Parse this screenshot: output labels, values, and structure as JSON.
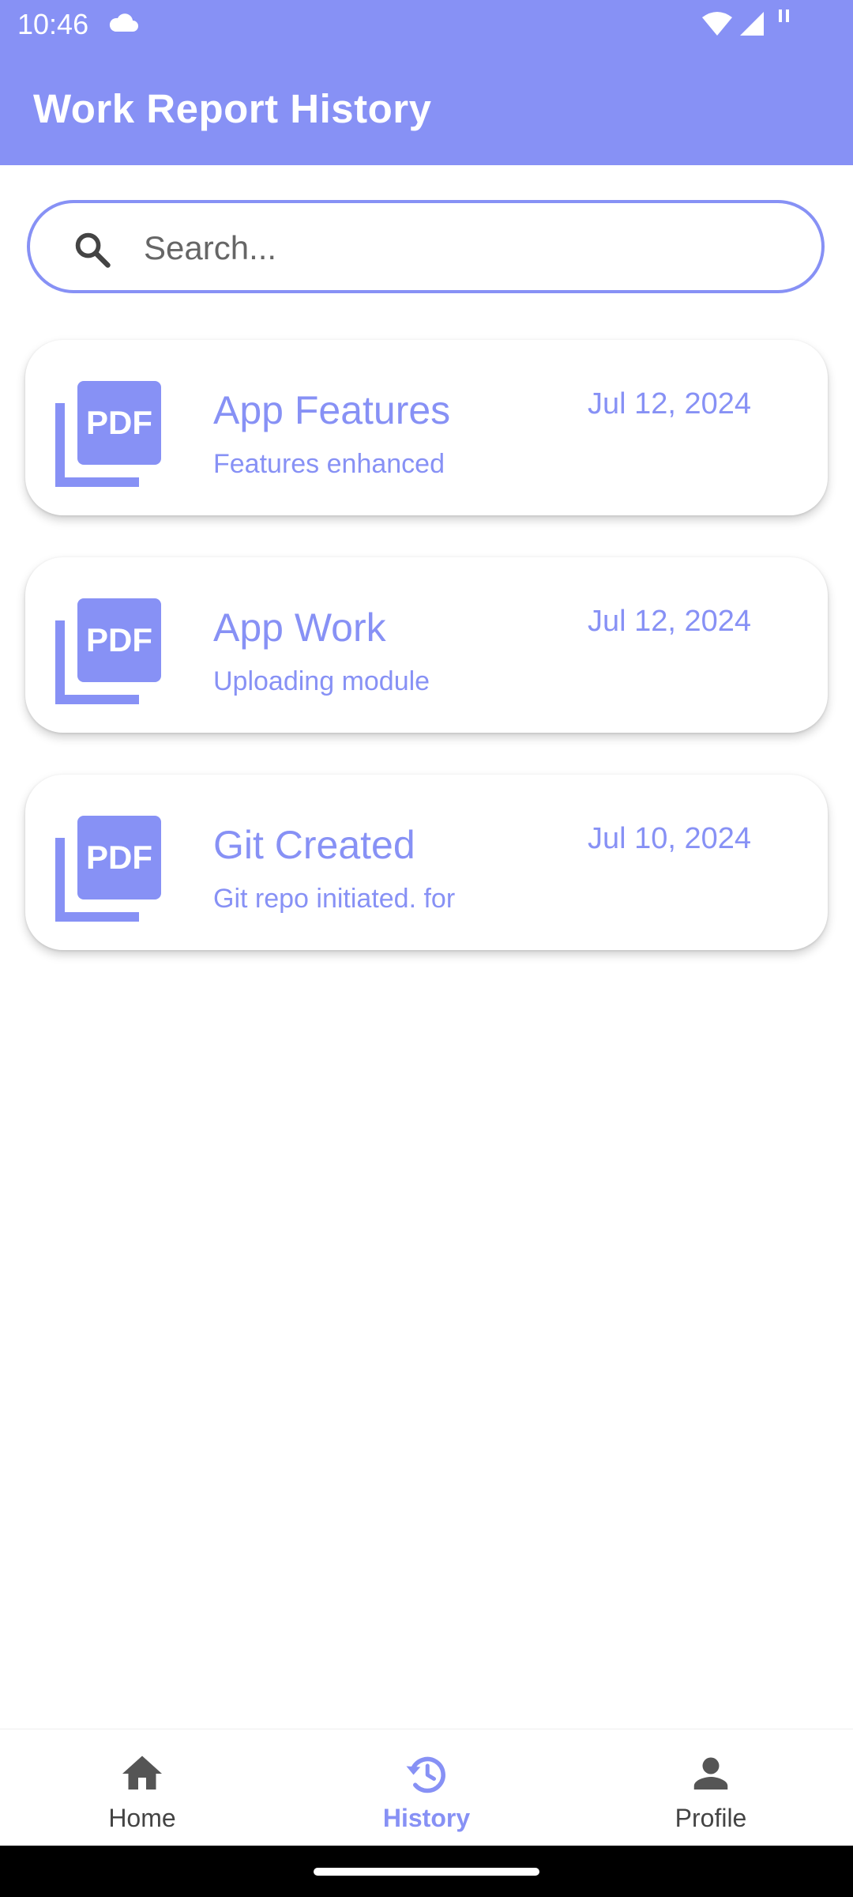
{
  "status_bar": {
    "time": "10:46"
  },
  "app_bar": {
    "title": "Work Report History"
  },
  "search": {
    "placeholder": "Search..."
  },
  "reports": [
    {
      "title": "App Features",
      "subtitle": "Features enhanced",
      "date": "Jul 12, 2024",
      "icon": "pdf-icon"
    },
    {
      "title": "App Work",
      "subtitle": "Uploading module",
      "date": "Jul 12, 2024",
      "icon": "pdf-icon"
    },
    {
      "title": "Git Created",
      "subtitle": "Git repo initiated. for",
      "date": "Jul 10, 2024",
      "icon": "pdf-icon"
    }
  ],
  "bottom_nav": {
    "items": [
      {
        "label": "Home",
        "icon": "home-icon",
        "active": false
      },
      {
        "label": "History",
        "icon": "history-icon",
        "active": true
      },
      {
        "label": "Profile",
        "icon": "profile-icon",
        "active": false
      }
    ]
  },
  "colors": {
    "accent": "#8791F5",
    "nav_inactive": "#444444",
    "background": "#FFFFFF"
  }
}
